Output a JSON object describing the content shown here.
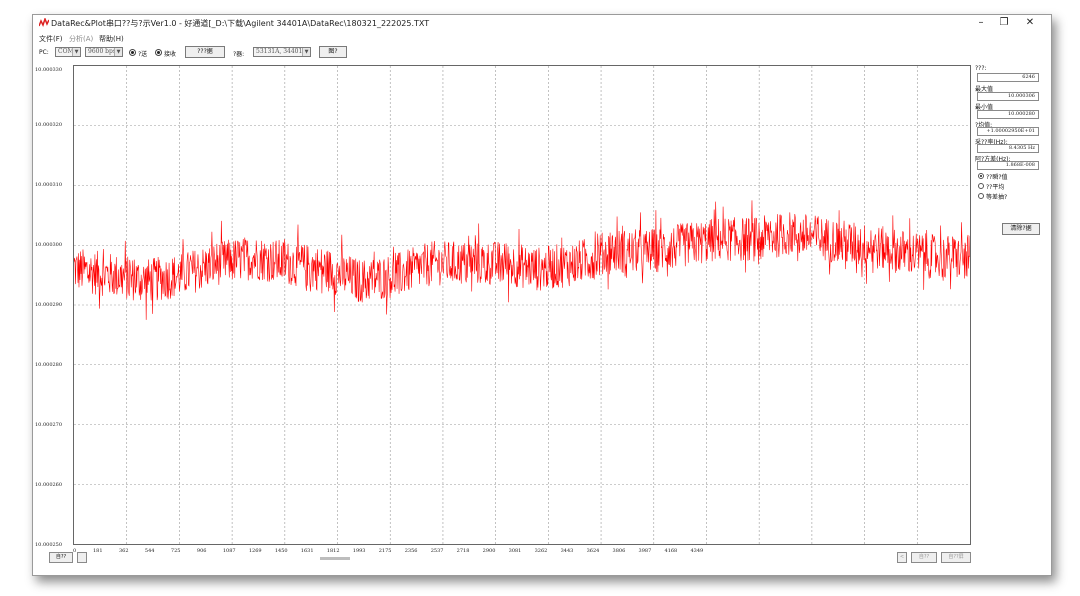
{
  "window": {
    "title": "DataRec&Plot串口??与?示Ver1.0 - 好通道[_D:\\下载\\Agilent 34401A\\DataRec\\180321_222025.TXT",
    "minimize_glyph": "–",
    "maximize_glyph": "❐",
    "close_glyph": "✕"
  },
  "menu": [
    {
      "label": "文件(F)"
    },
    {
      "label": "分析(A)"
    },
    {
      "label": "帮助(H)"
    }
  ],
  "toolbar": {
    "port_label": "PC:",
    "port_value": "COM1",
    "baud_value": "9600 bps",
    "send_label": "?送",
    "receive_label": "接收",
    "action_button": "???据",
    "device_label": "?器:",
    "device_value": "53131A, 34401A",
    "extra_button": "图?"
  },
  "plot": {
    "y_labels": [
      "10.000330",
      "10.000320",
      "10.000310",
      "10.000300",
      "10.000290",
      "10.000280",
      "10.000270",
      "10.000260",
      "10.000250"
    ],
    "x_labels": [
      "0",
      "181",
      "362",
      "544",
      "725",
      "906",
      "1087",
      "1269",
      "1450",
      "1631",
      "1812",
      "1993",
      "2175",
      "2356",
      "2537",
      "2718",
      "2900",
      "3081",
      "3262",
      "3443",
      "3624",
      "3806",
      "3987",
      "4168",
      "4349"
    ],
    "line_color": "#ff0000",
    "grid_color": "#9a9a9a"
  },
  "chart_data": {
    "type": "line",
    "title": "",
    "xlabel": "",
    "ylabel": "",
    "xlim": [
      0,
      6246
    ],
    "ylim": [
      10.00025,
      10.00033
    ],
    "grid": true,
    "series": [
      {
        "x": [
          0,
          250,
          500,
          750,
          1000,
          1250,
          1500,
          1750,
          2000,
          2250,
          2500,
          2750,
          3000,
          3250,
          3500,
          3750,
          4000,
          4250,
          4500,
          4750,
          5000,
          5250,
          5500,
          5750,
          6000,
          6246
        ],
        "y": [
          10.000296,
          10.000295,
          10.000294,
          10.000295,
          10.000297,
          10.000298,
          10.000297,
          10.000296,
          10.000294,
          10.000295,
          10.000297,
          10.000297,
          10.000297,
          10.000296,
          10.000297,
          10.000299,
          10.000299,
          10.0003,
          10.000301,
          10.000301,
          10.000302,
          10.000301,
          10.0003,
          10.000299,
          10.000298,
          10.000298
        ]
      }
    ]
  },
  "stats": {
    "count_label": "???:",
    "count_value": "6246",
    "max_label": "最大值",
    "max_value": "10.000306",
    "min_label": "最小值",
    "min_value": "10.000280",
    "avg_label": "?均值:",
    "avg_value": "+1.00002950E+01",
    "freq_label": "采??率(Hz):",
    "freq_value": "8.4305 Hz",
    "var_label": "阿?方差(Hz):",
    "var_value": "1.868E-008",
    "mode_options": [
      {
        "label": "??瞬?值",
        "checked": true
      },
      {
        "label": "??平均",
        "checked": false
      },
      {
        "label": "等差抽?",
        "checked": false
      }
    ],
    "clear_button": "清除?据"
  },
  "bottom": {
    "left_button": "自??",
    "right_small": "<",
    "right_auto": "自??",
    "right_auto2": "自??屏"
  }
}
